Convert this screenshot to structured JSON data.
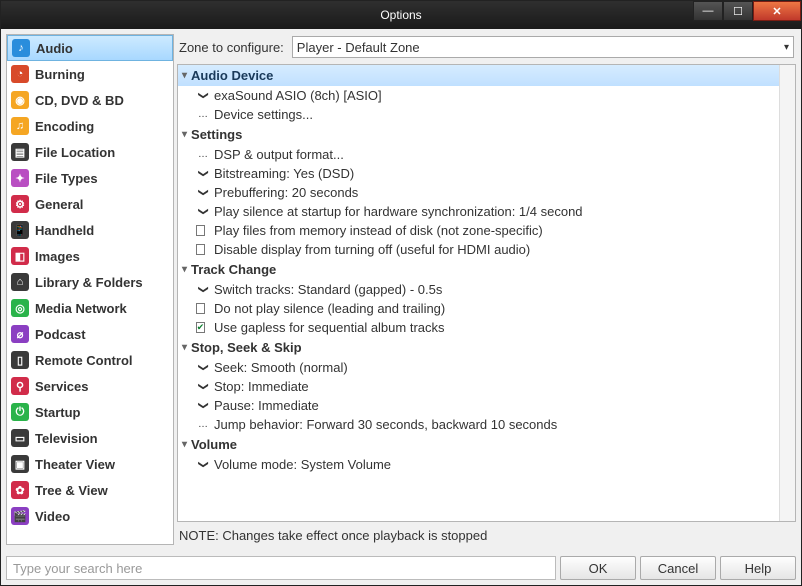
{
  "title": "Options",
  "sidebar": {
    "items": [
      {
        "label": "Audio",
        "color": "#2a8ddc",
        "glyph": "♪"
      },
      {
        "label": "Burning",
        "color": "#d84a2a",
        "glyph": "◔"
      },
      {
        "label": "CD, DVD & BD",
        "color": "#f5a623",
        "glyph": "◉"
      },
      {
        "label": "Encoding",
        "color": "#f5a623",
        "glyph": "♫"
      },
      {
        "label": "File Location",
        "color": "#3a3a3a",
        "glyph": "▤"
      },
      {
        "label": "File Types",
        "color": "#b94ec2",
        "glyph": "✦"
      },
      {
        "label": "General",
        "color": "#d12c4a",
        "glyph": "⚙"
      },
      {
        "label": "Handheld",
        "color": "#3a3a3a",
        "glyph": "📱"
      },
      {
        "label": "Images",
        "color": "#d12c4a",
        "glyph": "◧"
      },
      {
        "label": "Library & Folders",
        "color": "#3a3a3a",
        "glyph": "⌂"
      },
      {
        "label": "Media Network",
        "color": "#2ab34a",
        "glyph": "◎"
      },
      {
        "label": "Podcast",
        "color": "#8b3fc2",
        "glyph": "⌀"
      },
      {
        "label": "Remote Control",
        "color": "#3a3a3a",
        "glyph": "▯"
      },
      {
        "label": "Services",
        "color": "#d12c4a",
        "glyph": "⚲"
      },
      {
        "label": "Startup",
        "color": "#2ab34a",
        "glyph": "⏻"
      },
      {
        "label": "Television",
        "color": "#3a3a3a",
        "glyph": "▭"
      },
      {
        "label": "Theater View",
        "color": "#3a3a3a",
        "glyph": "▣"
      },
      {
        "label": "Tree & View",
        "color": "#d12c4a",
        "glyph": "✿"
      },
      {
        "label": "Video",
        "color": "#8b3fc2",
        "glyph": "🎬"
      }
    ],
    "active_index": 0
  },
  "zone": {
    "label": "Zone to configure:",
    "value": "Player - Default Zone"
  },
  "groups": [
    {
      "title": "Audio Device",
      "highlight": true,
      "rows": [
        {
          "kind": "expand",
          "text": "exaSound ASIO (8ch) [ASIO]"
        },
        {
          "kind": "more",
          "text": "Device settings..."
        }
      ]
    },
    {
      "title": "Settings",
      "rows": [
        {
          "kind": "more",
          "text": "DSP & output format..."
        },
        {
          "kind": "expand",
          "text": "Bitstreaming: Yes (DSD)"
        },
        {
          "kind": "expand",
          "text": "Prebuffering: 20 seconds"
        },
        {
          "kind": "expand",
          "text": "Play silence at startup for hardware synchronization: 1/4 second"
        },
        {
          "kind": "check",
          "checked": false,
          "text": "Play files from memory instead of disk (not zone-specific)"
        },
        {
          "kind": "check",
          "checked": false,
          "text": "Disable display from turning off (useful for HDMI audio)"
        }
      ]
    },
    {
      "title": "Track Change",
      "rows": [
        {
          "kind": "expand",
          "text": "Switch tracks: Standard (gapped) - 0.5s"
        },
        {
          "kind": "check",
          "checked": false,
          "text": "Do not play silence (leading and trailing)"
        },
        {
          "kind": "check",
          "checked": true,
          "text": "Use gapless for sequential album tracks"
        }
      ]
    },
    {
      "title": "Stop, Seek & Skip",
      "rows": [
        {
          "kind": "expand",
          "text": "Seek: Smooth (normal)"
        },
        {
          "kind": "expand",
          "text": "Stop: Immediate"
        },
        {
          "kind": "expand",
          "text": "Pause: Immediate"
        },
        {
          "kind": "more",
          "text": "Jump behavior: Forward 30 seconds, backward 10 seconds"
        }
      ]
    },
    {
      "title": "Volume",
      "rows": [
        {
          "kind": "expand",
          "text": "Volume mode: System Volume"
        }
      ]
    }
  ],
  "note": "NOTE: Changes take effect once playback is stopped",
  "search_placeholder": "Type your search here",
  "buttons": {
    "ok": "OK",
    "cancel": "Cancel",
    "help": "Help"
  }
}
